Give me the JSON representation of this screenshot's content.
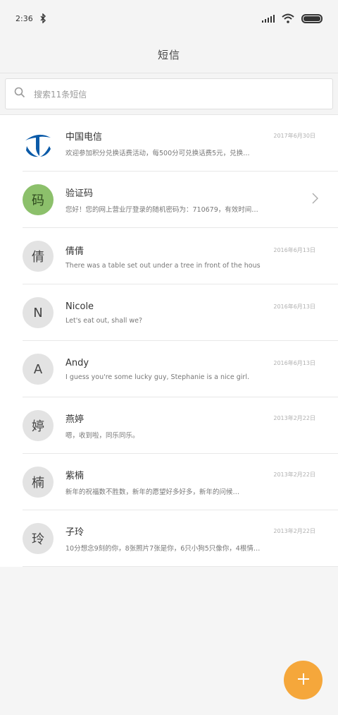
{
  "status_bar": {
    "time": "2:36",
    "icons": [
      "bluetooth-icon",
      "signal-icon",
      "wifi-icon",
      "battery-icon"
    ]
  },
  "header": {
    "title": "短信"
  },
  "search": {
    "placeholder": "搜索11条短信",
    "icon": "search-icon"
  },
  "conversations": [
    {
      "name": "中国电信",
      "time": "2017年6月30日",
      "preview": "欢迎参加积分兑换话费活动，每500分可兑换话费5元，兑换…",
      "avatar": "telecom-logo"
    },
    {
      "name": "验证码",
      "time": "",
      "preview": "您好！您的网上营业厅登录的随机密码为：710679，有效时间…",
      "avatar": "码",
      "has_chevron": true
    },
    {
      "name": "倩倩",
      "time": "2016年6月13日",
      "preview": "There was a table set out under a tree in front of the hous",
      "avatar": "倩"
    },
    {
      "name": "Nicole",
      "time": "2016年6月13日",
      "preview": "Let's eat out, shall we?",
      "avatar": "N"
    },
    {
      "name": "Andy",
      "time": "2016年6月13日",
      "preview": "I guess you're some lucky guy, Stephanie is a nice girl.",
      "avatar": "A"
    },
    {
      "name": "燕婷",
      "time": "2013年2月22日",
      "preview": "嗯，收到啦，同乐同乐。",
      "avatar": "婷"
    },
    {
      "name": "紫楠",
      "time": "2013年2月22日",
      "preview": "新年的祝福数不胜数，新年的愿望好多好多，新年的问候…",
      "avatar": "楠"
    },
    {
      "name": "子玲",
      "time": "2013年2月22日",
      "preview": "10分想念9刻的你，8张照片7张是你，6只小狗5只像你，4根情…",
      "avatar": "玲"
    }
  ],
  "fab": {
    "icon": "plus-icon",
    "color": "#f5a73b"
  }
}
